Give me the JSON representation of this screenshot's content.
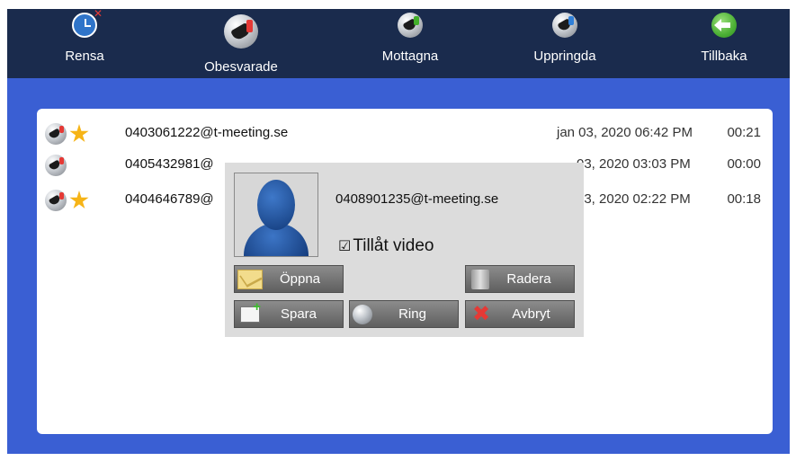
{
  "nav": [
    {
      "label": "Rensa",
      "icon": "clear-history-icon"
    },
    {
      "label": "Obesvarade",
      "icon": "missed-calls-icon",
      "active": true
    },
    {
      "label": "Mottagna",
      "icon": "received-calls-icon"
    },
    {
      "label": "Uppringda",
      "icon": "dialed-calls-icon"
    },
    {
      "label": "Tillbaka",
      "icon": "back-arrow-icon"
    }
  ],
  "calls": [
    {
      "address": "0403061222@t-meeting.se",
      "date": "jan 03, 2020 06:42 PM",
      "duration": "00:21",
      "favorite": true
    },
    {
      "address": "0405432981@",
      "date": "03, 2020 03:03 PM",
      "duration": "00:00",
      "favorite": false
    },
    {
      "address": "0404646789@",
      "date": "03, 2020 02:22 PM",
      "duration": "00:18",
      "favorite": true
    }
  ],
  "popup": {
    "address": "0408901235@t-meeting.se",
    "video_checkbox": "☑",
    "video_label": "Tillåt video",
    "buttons": {
      "open": "Öppna",
      "delete": "Radera",
      "save": "Spara",
      "call": "Ring",
      "cancel": "Avbryt"
    }
  },
  "colors": {
    "topbar": "#1a2b4d",
    "frame": "#3a5fd3",
    "missed_badge": "#e53935",
    "received_badge": "#43b02a",
    "dialed_badge": "#2f7fd8",
    "star": "#f6b417"
  }
}
